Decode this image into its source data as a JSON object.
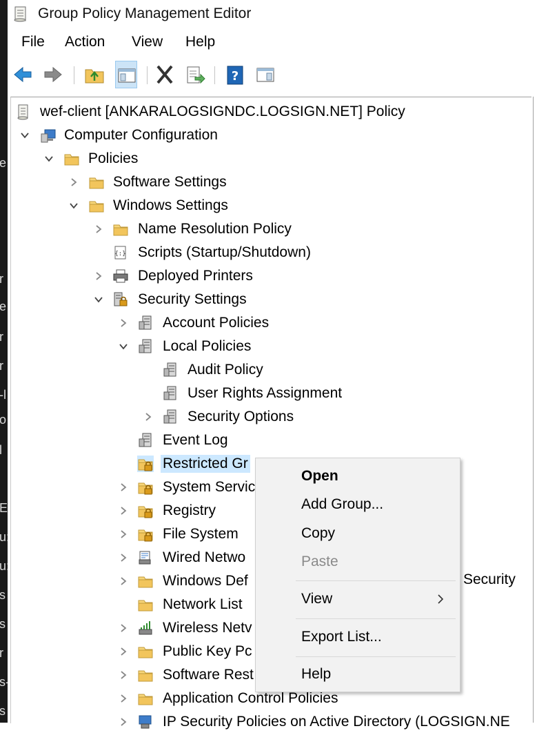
{
  "window": {
    "title": "Group Policy Management Editor"
  },
  "menu": [
    "File",
    "Action",
    "View",
    "Help"
  ],
  "toolbar": [
    "back-icon",
    "forward-icon",
    "up-folder-icon",
    "show-hide-console-tree-icon",
    "delete-icon",
    "export-list-icon",
    "help-icon",
    "properties-icon"
  ],
  "tree": {
    "root": "wef-client [ANKARALOGSIGNDC.LOGSIGN.NET] Policy",
    "computer_configuration": "Computer Configuration",
    "policies": "Policies",
    "software_settings": "Software Settings",
    "windows_settings": "Windows Settings",
    "name_resolution_policy": "Name Resolution Policy",
    "scripts": "Scripts (Startup/Shutdown)",
    "deployed_printers": "Deployed Printers",
    "security_settings": "Security Settings",
    "account_policies": "Account Policies",
    "local_policies": "Local Policies",
    "audit_policy": "Audit Policy",
    "user_rights_assignment": "User Rights Assignment",
    "security_options": "Security Options",
    "event_log": "Event Log",
    "restricted_groups": "Restricted Gr",
    "system_services": "System Servic",
    "registry": "Registry",
    "file_system": "File System",
    "wired_network": "Wired Netwo",
    "windows_defender": "Windows Def",
    "network_list": "Network List",
    "wireless_network": "Wireless Netv",
    "public_key": "Public Key Pc",
    "software_restriction": "Software Rest",
    "application_control": "Application Control Policies",
    "ip_security": "IP Security Policies on Active Directory (LOGSIGN.NE"
  },
  "peek_text": "Security",
  "context_menu": {
    "open": "Open",
    "add_group": "Add Group...",
    "copy": "Copy",
    "paste": "Paste",
    "view": "View",
    "export_list": "Export List...",
    "help": "Help"
  },
  "left_strip_chars": [
    "e",
    "r",
    "e",
    "r",
    "r",
    "-l",
    "o",
    "l",
    "E",
    "u:",
    "u:",
    "s",
    "s",
    "r",
    "s-",
    "s"
  ]
}
